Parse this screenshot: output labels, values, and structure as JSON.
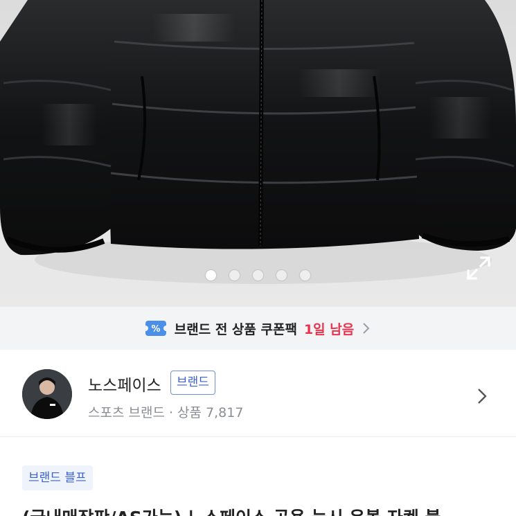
{
  "carousel": {
    "image_alt": "black down puffer jacket",
    "total_slides": 5,
    "active_slide": 1,
    "expand_icon": "expand-icon"
  },
  "coupon_banner": {
    "icon": "coupon-tag-icon",
    "text": "브랜드 전 상품 쿠폰팩",
    "highlight": "1일 남음",
    "highlight_color": "#e8344e",
    "chevron_icon": "chevron-right-icon"
  },
  "brand": {
    "name": "노스페이스",
    "badge": "브랜드",
    "subtitle": "스포츠 브랜드 · 상품 7,817",
    "chevron_icon": "chevron-right-icon"
  },
  "product": {
    "category_badge": "브랜드 블프",
    "title": "(국내매장판/AS가능) 노스페이스 공용 눕시 온볼 자켓 블"
  },
  "colors": {
    "accent_blue": "#3a5fd0",
    "badge_bg": "#eef3fc",
    "banner_bg": "#f3f4f6"
  }
}
